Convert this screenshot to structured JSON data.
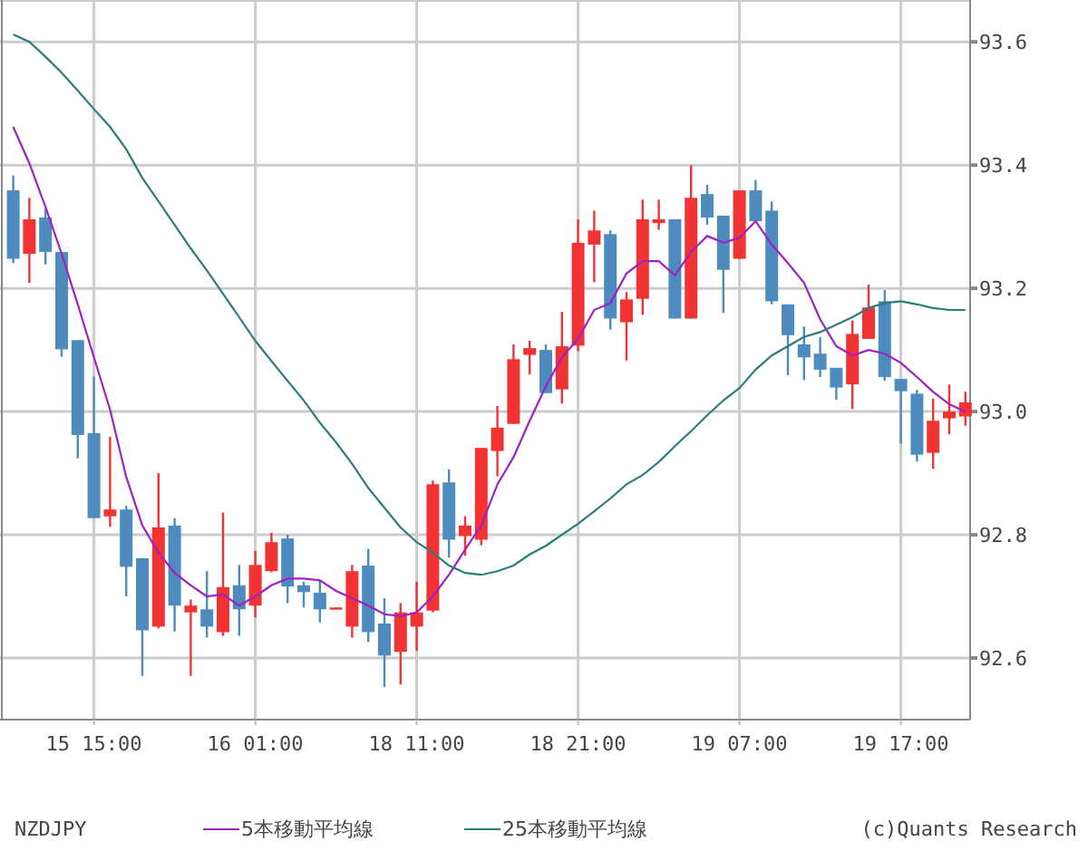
{
  "chart": {
    "chart_data": {
      "type": "candlestick",
      "grid": true,
      "ylim": [
        92.5,
        93.668
      ],
      "categories": [
        null,
        null,
        null,
        null,
        null,
        "15 15:00",
        null,
        null,
        null,
        null,
        null,
        null,
        null,
        null,
        null,
        "16 01:00",
        null,
        null,
        null,
        null,
        null,
        null,
        null,
        null,
        null,
        "18 11:00",
        null,
        null,
        null,
        null,
        null,
        null,
        null,
        null,
        null,
        "18 21:00",
        null,
        null,
        null,
        null,
        null,
        null,
        null,
        null,
        null,
        "19 07:00",
        null,
        null,
        null,
        null,
        null,
        null,
        null,
        null,
        null,
        "19 17:00",
        null,
        null,
        null,
        null
      ],
      "yticks": [
        {
          "value": 92.6,
          "label": "92.6"
        },
        {
          "value": 92.8,
          "label": "92.8"
        },
        {
          "value": 93,
          "label": "93.0"
        },
        {
          "value": 93.2,
          "label": "93.2"
        },
        {
          "value": 93.4,
          "label": "93.4"
        },
        {
          "value": 93.6,
          "label": "93.6"
        }
      ],
      "ohlc": [
        [
          93.359,
          93.383,
          93.241,
          93.248
        ],
        [
          93.256,
          93.347,
          93.209,
          93.312
        ],
        [
          93.315,
          93.329,
          93.239,
          93.259
        ],
        [
          93.259,
          93.259,
          93.089,
          93.101
        ],
        [
          93.116,
          93.116,
          92.924,
          92.962
        ],
        [
          92.965,
          93.057,
          92.827,
          92.827
        ],
        [
          92.83,
          92.959,
          92.813,
          92.841
        ],
        [
          92.841,
          92.847,
          92.7,
          92.748
        ],
        [
          92.762,
          92.762,
          92.571,
          92.645
        ],
        [
          92.651,
          92.9,
          92.648,
          92.812
        ],
        [
          92.815,
          92.827,
          92.643,
          92.685
        ],
        [
          92.674,
          92.695,
          92.571,
          92.685
        ],
        [
          92.679,
          92.741,
          92.633,
          92.651
        ],
        [
          92.642,
          92.836,
          92.636,
          92.715
        ],
        [
          92.718,
          92.751,
          92.636,
          92.679
        ],
        [
          92.685,
          92.774,
          92.666,
          92.751
        ],
        [
          92.741,
          92.803,
          92.739,
          92.788
        ],
        [
          92.794,
          92.8,
          92.689,
          92.716
        ],
        [
          92.718,
          92.724,
          92.682,
          92.707
        ],
        [
          92.706,
          92.726,
          92.658,
          92.679
        ],
        [
          92.679,
          92.682,
          92.679,
          92.682
        ],
        [
          92.651,
          92.751,
          92.633,
          92.741
        ],
        [
          92.75,
          92.777,
          92.626,
          92.642
        ],
        [
          92.656,
          92.697,
          92.553,
          92.604
        ],
        [
          92.61,
          92.689,
          92.557,
          92.674
        ],
        [
          92.651,
          92.724,
          92.612,
          92.674
        ],
        [
          92.677,
          92.888,
          92.674,
          92.882
        ],
        [
          92.885,
          92.906,
          92.763,
          92.792
        ],
        [
          92.798,
          92.83,
          92.766,
          92.815
        ],
        [
          92.792,
          92.941,
          92.783,
          92.941
        ],
        [
          92.936,
          93.009,
          92.895,
          92.974
        ],
        [
          92.98,
          93.109,
          92.98,
          93.085
        ],
        [
          93.092,
          93.115,
          93.06,
          93.103
        ],
        [
          93.1,
          93.109,
          93.03,
          93.03
        ],
        [
          93.036,
          93.162,
          93.013,
          93.106
        ],
        [
          93.107,
          93.312,
          93.098,
          93.274
        ],
        [
          93.271,
          93.326,
          93.21,
          93.294
        ],
        [
          93.288,
          93.294,
          93.133,
          93.151
        ],
        [
          93.145,
          93.194,
          93.083,
          93.182
        ],
        [
          93.183,
          93.344,
          93.157,
          93.312
        ],
        [
          93.306,
          93.344,
          93.295,
          93.312
        ],
        [
          93.312,
          93.312,
          93.151,
          93.151
        ],
        [
          93.151,
          93.4,
          93.151,
          93.347
        ],
        [
          93.353,
          93.368,
          93.303,
          93.315
        ],
        [
          93.318,
          93.318,
          93.16,
          93.23
        ],
        [
          93.248,
          93.359,
          93.248,
          93.359
        ],
        [
          93.359,
          93.376,
          93.309,
          93.309
        ],
        [
          93.326,
          93.341,
          93.174,
          93.179
        ],
        [
          93.174,
          93.174,
          93.059,
          93.124
        ],
        [
          93.109,
          93.138,
          93.051,
          93.088
        ],
        [
          93.094,
          93.121,
          93.056,
          93.068
        ],
        [
          93.071,
          93.071,
          93.019,
          93.039
        ],
        [
          93.044,
          93.148,
          93.004,
          93.126
        ],
        [
          93.118,
          93.206,
          93.118,
          93.169
        ],
        [
          93.179,
          93.197,
          93.05,
          93.056
        ],
        [
          93.053,
          93.053,
          92.948,
          93.033
        ],
        [
          93.029,
          93.035,
          92.919,
          92.93
        ],
        [
          92.933,
          93.021,
          92.907,
          92.985
        ],
        [
          92.989,
          93.044,
          92.963,
          93.0
        ],
        [
          92.992,
          93.032,
          92.977,
          93.015
        ]
      ],
      "series": [
        {
          "name": "5本移動平均線",
          "type": "line",
          "color": "#a021c2",
          "values": [
            93.462,
            93.403,
            93.332,
            93.256,
            93.174,
            93.088,
            93.003,
            92.894,
            92.815,
            92.771,
            92.738,
            92.718,
            92.7,
            92.703,
            92.685,
            92.7,
            92.718,
            92.729,
            92.729,
            92.726,
            92.709,
            92.697,
            92.685,
            92.671,
            92.668,
            92.674,
            92.7,
            92.735,
            92.776,
            92.815,
            92.882,
            92.926,
            92.985,
            93.041,
            93.088,
            93.118,
            93.165,
            93.176,
            93.224,
            93.244,
            93.244,
            93.221,
            93.259,
            93.285,
            93.274,
            93.282,
            93.309,
            93.271,
            93.241,
            93.209,
            93.15,
            93.106,
            93.091,
            93.1,
            93.094,
            93.079,
            93.056,
            93.032,
            93.012,
            93.0
          ]
        },
        {
          "name": "25本移動平均線",
          "type": "line",
          "color": "#2a7d7a",
          "values": [
            93.612,
            93.6,
            93.576,
            93.55,
            93.521,
            93.491,
            93.462,
            93.426,
            93.379,
            93.341,
            93.303,
            93.265,
            93.229,
            93.191,
            93.153,
            93.115,
            93.082,
            93.05,
            93.018,
            92.982,
            92.95,
            92.915,
            92.876,
            92.844,
            92.812,
            92.788,
            92.771,
            92.75,
            92.738,
            92.735,
            92.741,
            92.75,
            92.768,
            92.782,
            92.8,
            92.818,
            92.838,
            92.859,
            92.882,
            92.897,
            92.918,
            92.944,
            92.968,
            92.994,
            93.018,
            93.038,
            93.068,
            93.091,
            93.106,
            93.121,
            93.129,
            93.141,
            93.153,
            93.168,
            93.176,
            93.179,
            93.174,
            93.168,
            93.165,
            93.165
          ]
        }
      ]
    }
  },
  "footer": {
    "symbol": "NZDJPY",
    "credit": "(c)Quants Research"
  }
}
